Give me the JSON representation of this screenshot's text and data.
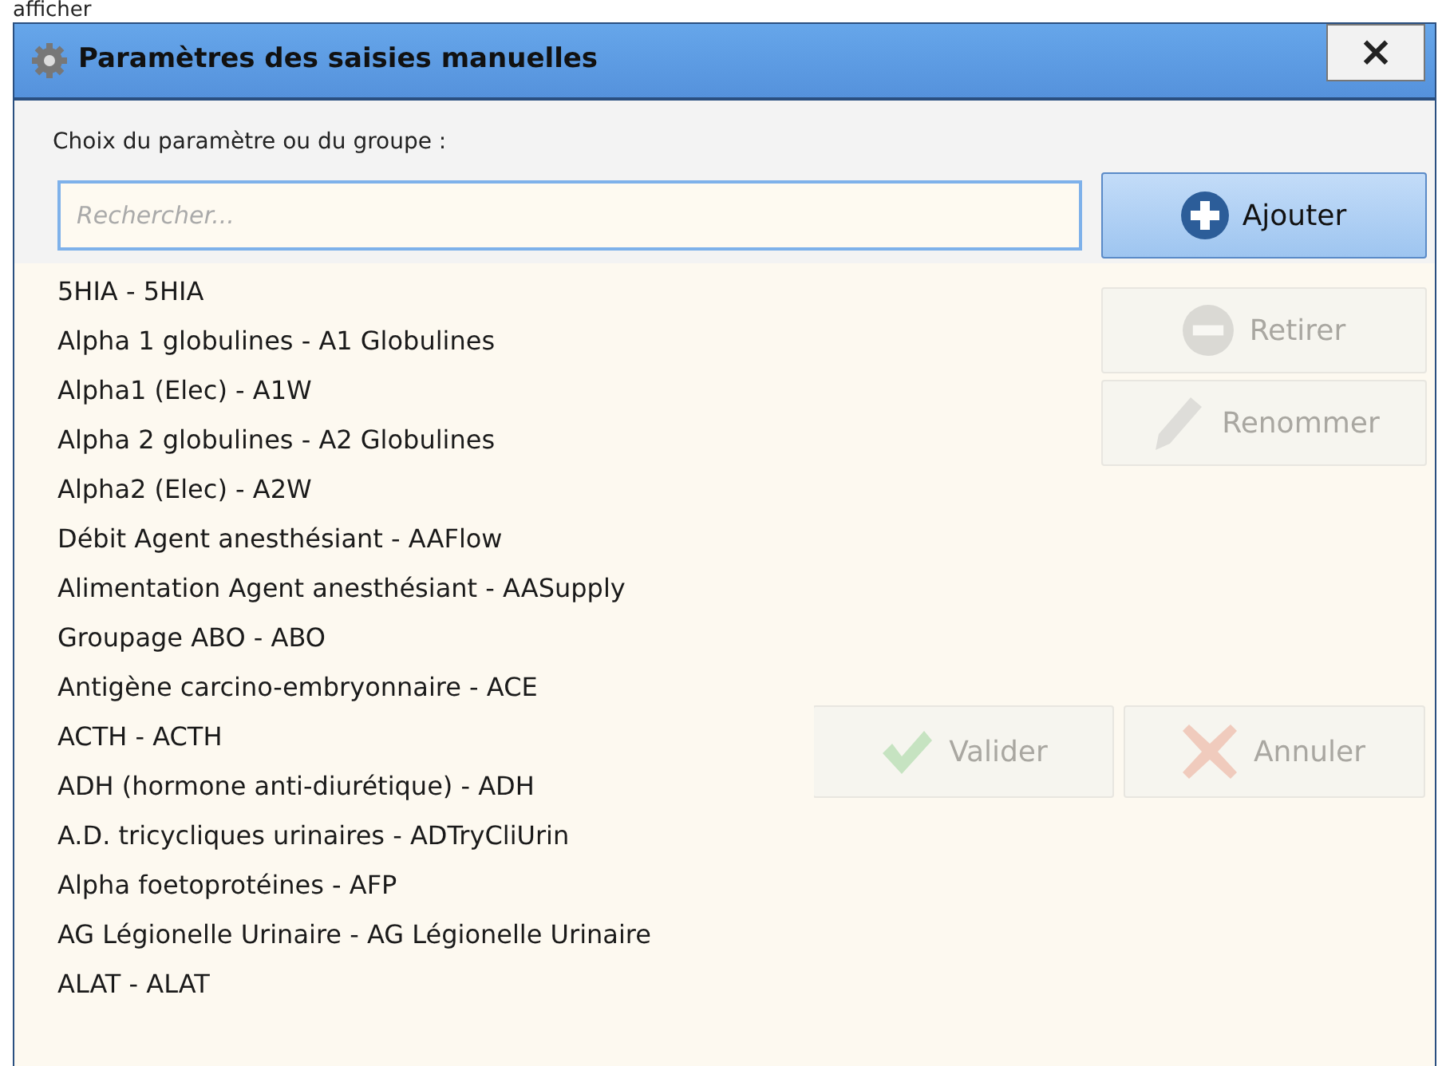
{
  "page_caption": "afficher",
  "window": {
    "title": "Paramètres des saisies manuelles",
    "close": "×"
  },
  "search": {
    "label": "Choix du paramètre ou du groupe :",
    "placeholder": "Rechercher..."
  },
  "add_button": {
    "label": "Ajouter",
    "disabled": false
  },
  "side_buttons": [
    {
      "label": "Retirer",
      "kind": "remove",
      "disabled": true
    },
    {
      "label": "Renommer",
      "kind": "rename",
      "disabled": true
    }
  ],
  "dropdown": {
    "items": [
      "5HIA - 5HIA",
      "Alpha 1 globulines - A1 Globulines",
      "Alpha1 (Elec) - A1W",
      "Alpha 2 globulines - A2 Globulines",
      "Alpha2 (Elec) - A2W",
      "Débit Agent anesthésiant - AAFlow",
      "Alimentation Agent anesthésiant - AASupply",
      "Groupage ABO - ABO",
      "Antigène carcino-embryonnaire - ACE",
      "ACTH - ACTH",
      "ADH (hormone anti-diurétique) - ADH",
      "A.D. tricycliques urinaires - ADTryCliUrin",
      "Alpha foetoprotéines - AFP",
      "AG Légionelle Urinaire - AG Légionelle Urinaire",
      "ALAT - ALAT"
    ]
  },
  "footer_buttons": [
    {
      "label": "Valider",
      "kind": "ok",
      "disabled": true
    },
    {
      "label": "Annuler",
      "kind": "cancel",
      "disabled": true
    }
  ]
}
